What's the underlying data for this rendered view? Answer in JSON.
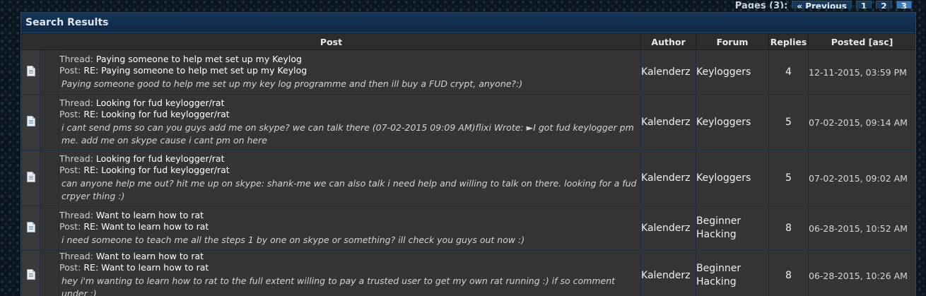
{
  "pager": {
    "label": "Pages (3):",
    "previous": "« Previous",
    "pages": [
      "1",
      "2",
      "3"
    ],
    "current_page": "3"
  },
  "panel": {
    "title": "Search Results"
  },
  "columns": {
    "post": "Post",
    "author": "Author",
    "forum": "Forum",
    "replies": "Replies",
    "posted": "Posted [asc]"
  },
  "labels": {
    "thread": "Thread:",
    "post": "Post:"
  },
  "rows": [
    {
      "thread": "Paying someone to help met set up my Keylog",
      "post": "RE: Paying someone to help met set up my Keylog",
      "excerpt": "Paying someone good to help me set up my key log programme and then ill buy a FUD crypt, anyone?:)",
      "author": "Kalenderz",
      "forum": "Keyloggers",
      "replies": "4",
      "posted": "12-11-2015, 03:59 PM"
    },
    {
      "thread": "Looking for fud keylogger/rat",
      "post": "RE: Looking for fud keylogger/rat",
      "excerpt": "i cant send pms so can you guys add me on skype? we can talk there (07-02-2015 09:09 AM)flixi Wrote: ►I got fud keylogger pm me. add me on skype cause i cant pm on here",
      "author": "Kalenderz",
      "forum": "Keyloggers",
      "replies": "5",
      "posted": "07-02-2015, 09:14 AM"
    },
    {
      "thread": "Looking for fud keylogger/rat",
      "post": "RE: Looking for fud keylogger/rat",
      "excerpt": "can anyone help me out? hit me up on skype: shank-me we can also talk i need help and willing to talk on there. looking for a fud crpyer thing :)",
      "author": "Kalenderz",
      "forum": "Keyloggers",
      "replies": "5",
      "posted": "07-02-2015, 09:02 AM"
    },
    {
      "thread": "Want to learn how to rat",
      "post": "RE: Want to learn how to rat",
      "excerpt": "i need someone to teach me all the steps 1 by one on skype or something? ill check you guys out now :)",
      "author": "Kalenderz",
      "forum": "Beginner Hacking",
      "replies": "8",
      "posted": "06-28-2015, 10:52 AM"
    },
    {
      "thread": "Want to learn how to rat",
      "post": "RE: Want to learn how to rat",
      "excerpt": "hey i'm wanting to learn how to rat to the full extent willing to pay a trusted user to get my own rat running :) if so comment under :)",
      "author": "Kalenderz",
      "forum": "Beginner Hacking",
      "replies": "8",
      "posted": "06-28-2015, 10:26 AM"
    }
  ]
}
